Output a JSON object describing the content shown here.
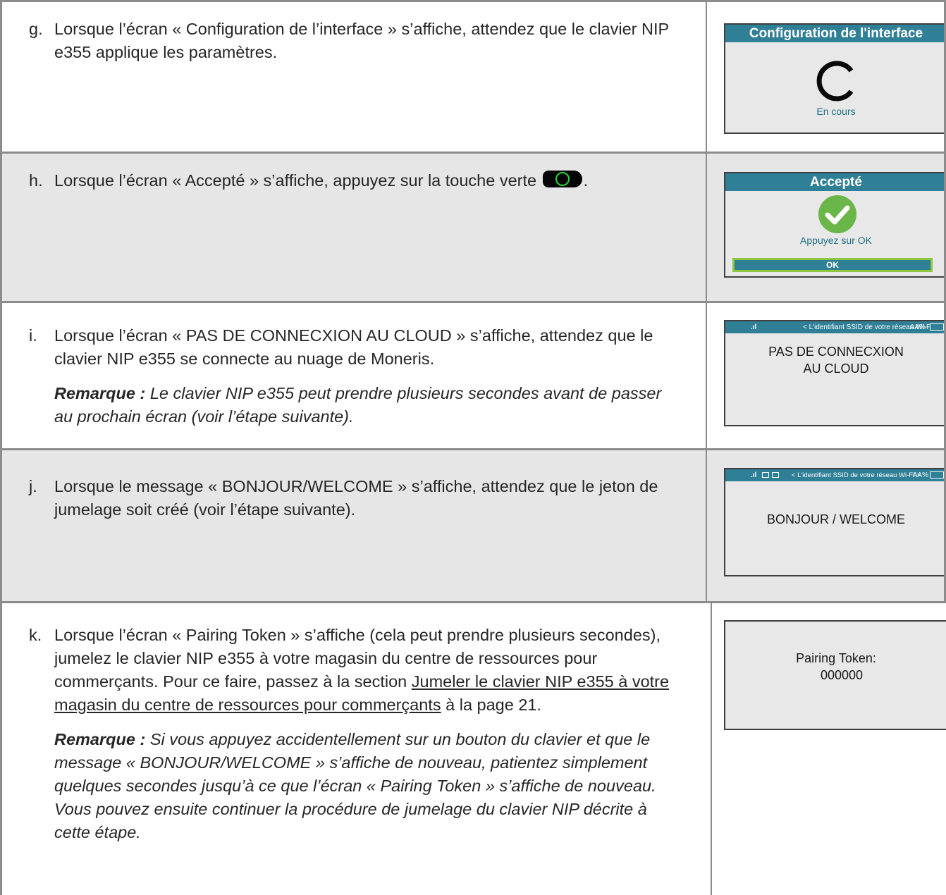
{
  "steps": {
    "g": {
      "letter": "g.",
      "text": "Lorsque l’écran « Configuration de l’interface » s’affiche, attendez que le clavier NIP e355 applique les paramètres.",
      "screen": {
        "title": "Configuration de l'interface",
        "caption": "En cours"
      }
    },
    "h": {
      "letter": "h.",
      "text": "Lorsque l’écran « Accepté » s’affiche, appuyez sur la touche verte",
      "text_end": ".",
      "screen": {
        "title": "Accepté",
        "caption": "Appuyez sur OK",
        "button": "OK"
      }
    },
    "i": {
      "letter": "i.",
      "text": "Lorsque l’écran « PAS DE CONNECXION AU CLOUD » s’affiche, attendez que le clavier NIP e355 se connecte au nuage de Moneris.",
      "note_label": "Remarque :",
      "note_text": " Le clavier NIP e355 peut prendre plusieurs secondes avant de passer au prochain écran (voir l’étape suivante).",
      "screen": {
        "status_ssid": "< L'identifiant SSID de votre réseau Wi-Fi >",
        "status_battery": "AA%",
        "line1": "PAS DE CONNECXION",
        "line2": "AU CLOUD"
      }
    },
    "j": {
      "letter": "j.",
      "text": "Lorsque le message « BONJOUR/WELCOME » s’affiche, attendez que le jeton de jumelage soit créé (voir l’étape suivante).",
      "screen": {
        "status_ssid": "< L'identifiant SSID de votre réseau Wi-Fi >",
        "status_battery": "AA%",
        "message": "BONJOUR / WELCOME"
      }
    },
    "k": {
      "letter": "k.",
      "text_before": "Lorsque l’écran « Pairing Token » s’affiche (cela peut prendre plusieurs secondes), jumelez le clavier NIP e355 à votre magasin du centre de ressources pour commerçants. Pour ce faire, passez à la section ",
      "link": "Jumeler le clavier NIP e355 à votre magasin du centre de ressources pour commerçants",
      "text_after": " à la page 21.",
      "note_label": "Remarque :",
      "note_text": " Si vous appuyez accidentellement sur un bouton du clavier et que le message « BONJOUR/WELCOME » s’affiche de nouveau, patientez simplement quelques secondes jusqu’à ce que l’écran « Pairing Token » s’affiche de nouveau. Vous pouvez ensuite continuer la procédure de jumelage du clavier NIP décrite à cette étape.",
      "screen": {
        "line1": "Pairing Token:",
        "line2": "000000"
      }
    }
  },
  "colors": {
    "screen_header": "#2f7f97",
    "screen_bg": "#e8e8e8",
    "check_green": "#6ab648",
    "ok_border": "#8dc63f",
    "row_gray": "#e7e6e6"
  }
}
